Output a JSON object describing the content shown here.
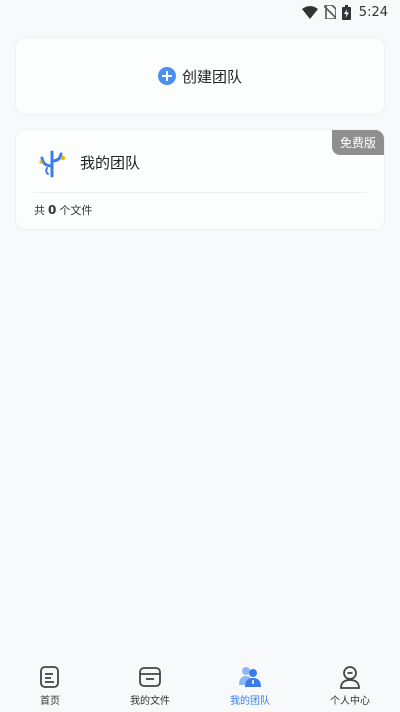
{
  "status_bar": {
    "time": "5:24"
  },
  "create_team": {
    "label": "创建团队"
  },
  "team": {
    "name": "我的团队",
    "badge": "免费版",
    "count_prefix": "共",
    "file_count": "0",
    "count_suffix": "个文件"
  },
  "tabs": [
    {
      "label": "首页",
      "icon": "home-doc-icon",
      "active": false
    },
    {
      "label": "我的文件",
      "icon": "folder-icon",
      "active": false
    },
    {
      "label": "我的团队",
      "icon": "team-icon",
      "active": true
    },
    {
      "label": "个人中心",
      "icon": "person-icon",
      "active": false
    }
  ],
  "colors": {
    "accent": "#3c7bea",
    "badge": "#8f8f8f",
    "background": "#f7f9fa"
  }
}
